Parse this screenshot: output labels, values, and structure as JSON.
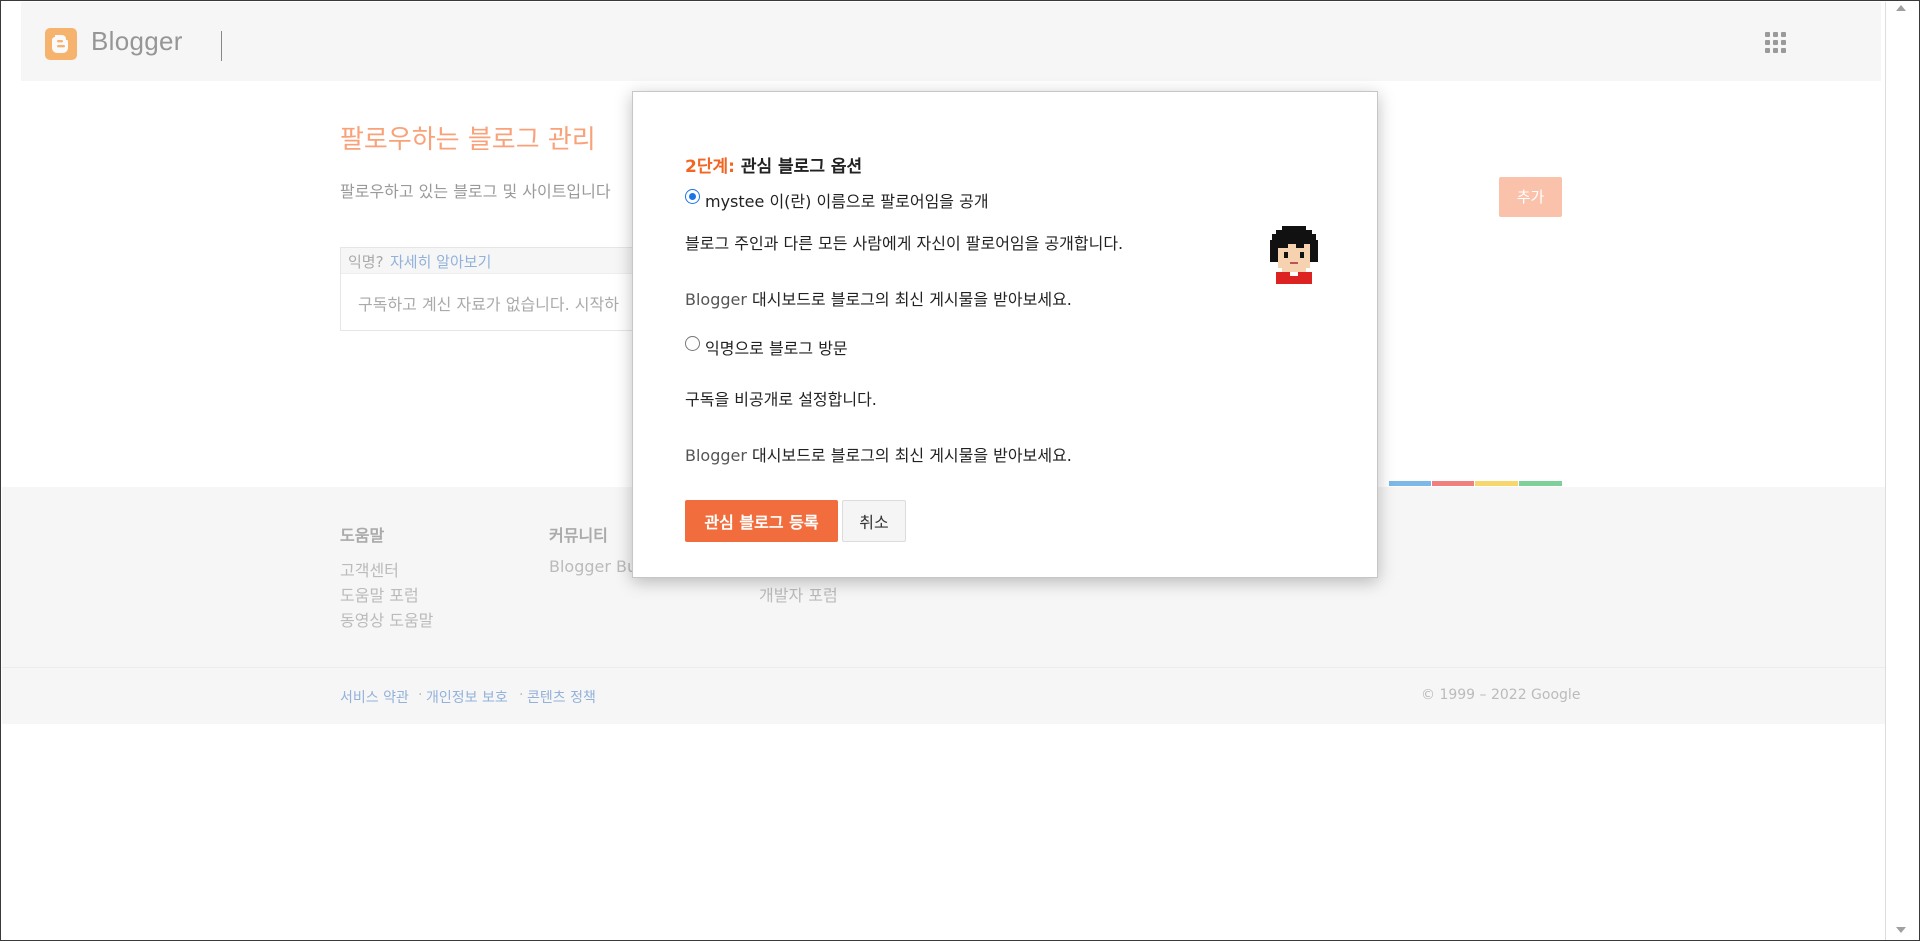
{
  "header": {
    "logo_text": "Blogger",
    "brand_color": "#f57d00"
  },
  "page": {
    "title": "팔로우하는 블로그 관리",
    "subtitle": "팔로우하고 있는 블로그 및 사이트입니다",
    "add_button": "추가",
    "anon_question": "익명?",
    "anon_link": "자세히 알아보기",
    "empty_text": "구독하고 계신 자료가 없습니다. 시작하"
  },
  "footer": {
    "columns": [
      {
        "title": "도움말",
        "links": [
          "고객센터",
          "도움말 포럼",
          "동영상 도움말"
        ]
      },
      {
        "title": "커뮤니티",
        "links": [
          "Blogger Bu"
        ]
      },
      {
        "title": "",
        "links": [
          "개발자 포럼"
        ]
      }
    ],
    "legal_links": [
      "서비스 약관",
      "개인정보 보호",
      "콘텐츠 정책"
    ],
    "legal_separator": "·",
    "copyright": "© 1999 – 2022 Google",
    "strip_colors": [
      "#7cb9e8",
      "#f08080",
      "#f5d76e",
      "#7fcf9b"
    ]
  },
  "modal": {
    "step_label": "2단계:",
    "title": "관심 블로그 옵션",
    "option_public": {
      "label": "mystee 이(란) 이름으로 팔로어임을 공개",
      "selected": true,
      "desc": "블로그 주인과 다른 모든 사람에게 자신이 팔로어임을 공개합니다.",
      "dashboard_prefix": "Blogger",
      "dashboard_rest": " 대시보드로 블로그의 최신 게시물을 받아보세요."
    },
    "option_anon": {
      "label": "익명으로 블로그 방문",
      "selected": false,
      "desc": "구독을 비공개로 설정합니다.",
      "dashboard_prefix": "Blogger",
      "dashboard_rest": " 대시보드로 블로그의 최신 게시물을 받아보세요."
    },
    "submit_button": "관심 블로그 등록",
    "cancel_button": "취소",
    "accent_color": "#f26d3d"
  }
}
